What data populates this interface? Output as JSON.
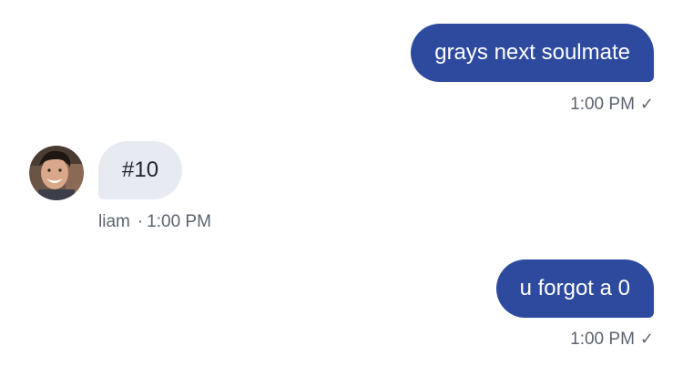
{
  "messages": [
    {
      "direction": "outgoing",
      "text": "grays next soulmate",
      "time": "1:00 PM",
      "status_icon": "check-icon"
    },
    {
      "direction": "incoming",
      "sender": "liam",
      "separator": "·",
      "text": "#10",
      "time": "1:00 PM",
      "avatar_icon": "user-avatar"
    },
    {
      "direction": "outgoing",
      "text": "u forgot a 0",
      "time": "1:00 PM",
      "status_icon": "check-icon"
    }
  ],
  "glyphs": {
    "check": "✓"
  },
  "colors": {
    "outgoing_bubble": "#2e4a9e",
    "incoming_bubble": "#e7ebf1",
    "meta_text": "#5c6470"
  }
}
